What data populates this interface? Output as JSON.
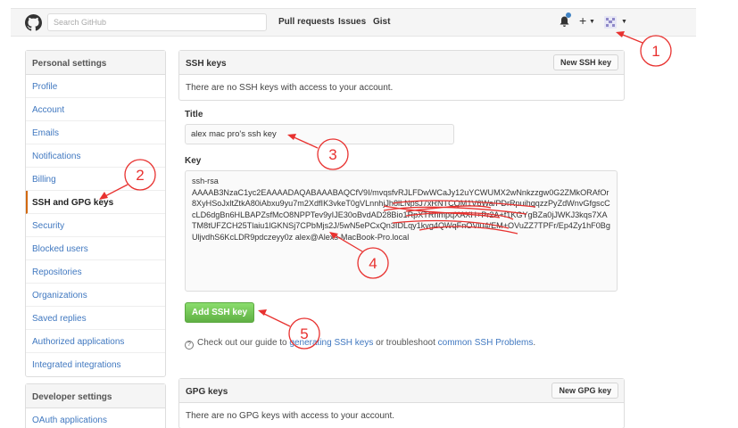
{
  "header": {
    "search_placeholder": "Search GitHub",
    "nav": [
      "Pull requests",
      "Issues",
      "Gist"
    ],
    "plus": "+"
  },
  "sidebar": {
    "personal_title": "Personal settings",
    "items": [
      {
        "label": "Profile"
      },
      {
        "label": "Account"
      },
      {
        "label": "Emails"
      },
      {
        "label": "Notifications"
      },
      {
        "label": "Billing"
      },
      {
        "label": "SSH and GPG keys",
        "selected": true
      },
      {
        "label": "Security"
      },
      {
        "label": "Blocked users"
      },
      {
        "label": "Repositories"
      },
      {
        "label": "Organizations"
      },
      {
        "label": "Saved replies"
      },
      {
        "label": "Authorized applications"
      },
      {
        "label": "Integrated integrations"
      }
    ],
    "developer_title": "Developer settings",
    "developer_items": [
      {
        "label": "OAuth applications"
      }
    ]
  },
  "ssh": {
    "title": "SSH keys",
    "new_button": "New SSH key",
    "empty": "There are no SSH keys with access to your account.",
    "title_label": "Title",
    "title_value": "alex mac pro's ssh key",
    "key_label": "Key",
    "key_value": "ssh-rsa\nAAAAB3NzaC1yc2EAAAADAQABAAABAQCfV9I/mvqsfvRJLFDwWCaJy12uYCWUMX2wNnkzzgw0G2ZMkORAfOr8XyHSoJxltZtkA80iAbxu9yu7m2XdfIK3vkeT0gVLnnhjJh8lLNpsJ7xRNTCQM1V6Wa/PDrRpuihqqzzPyZdWnvGfgscCcLD6dgBn6HLBAPZsfMcO8NPPTev9yIJE30oBvdAD28Bio1RpXTRnmpqXAXH+Pr2A+f1KGYgBZa0jJWKJ3kqs7XATM8tUFZCH25Tlaiu1lGKNSj7CPbMjs2J/5wN5ePCxQn3IDLqy1kvg4QWqFnOVlu4/EM+OVuZZ7TPFr/Ep4Zy1hF0BgUljvdhS6KcLDR9pdczeyy0z alex@Alexs-MacBook-Pro.local",
    "add_button": "Add SSH key",
    "hint_prefix": "Check out our guide to",
    "hint_link1": "generating SSH keys",
    "hint_middle": "or troubleshoot",
    "hint_link2": "common SSH Problems",
    "hint_suffix": "."
  },
  "gpg": {
    "title": "GPG keys",
    "new_button": "New GPG key",
    "empty": "There are no GPG keys with access to your account."
  },
  "annotations": [
    "1",
    "2",
    "3",
    "4",
    "5"
  ],
  "colors": {
    "annotation": "#e8312f",
    "link": "#4078c0",
    "green": "#60b044",
    "selected_border": "#d26911"
  }
}
